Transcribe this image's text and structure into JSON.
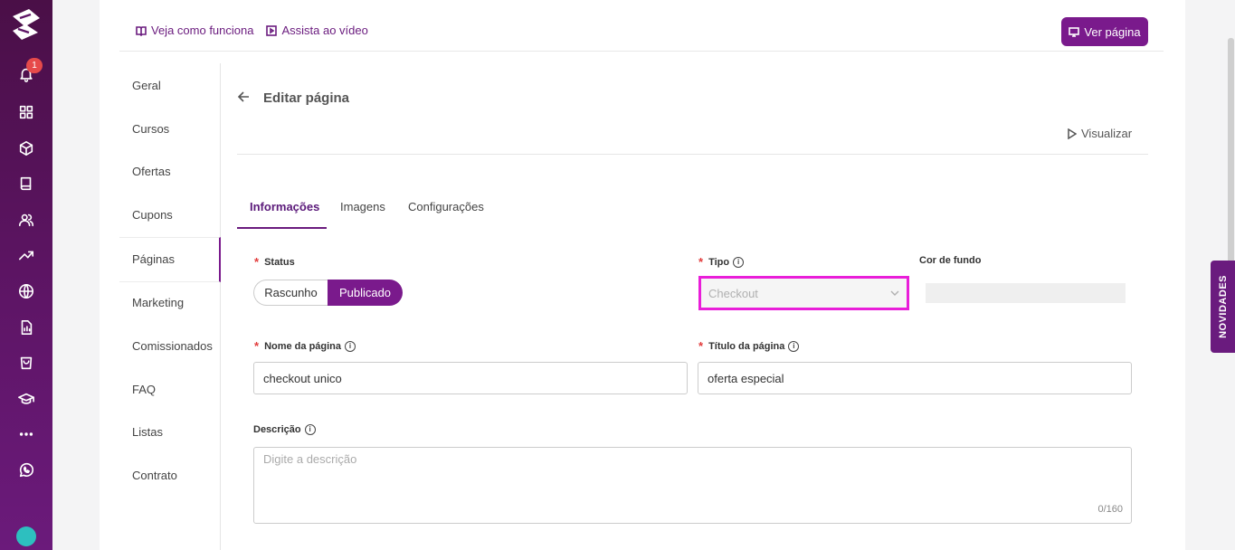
{
  "rail": {
    "notification_count": "1",
    "icons": [
      "bell-icon",
      "dashboard-grid-icon",
      "cube-icon",
      "book-icon",
      "users-icon",
      "trending-up-icon",
      "globe-icon",
      "report-icon",
      "shopping-bag-icon",
      "graduation-cap-icon",
      "more-dots-icon",
      "whatsapp-icon"
    ]
  },
  "top_links": {
    "how_it_works": "Veja como funciona",
    "watch_video": "Assista ao vídeo",
    "view_page_button": "Ver página"
  },
  "nav": {
    "items": [
      "Geral",
      "Cursos",
      "Ofertas",
      "Cupons",
      "Páginas",
      "Marketing",
      "Comissionados",
      "FAQ",
      "Listas",
      "Contrato"
    ],
    "active": "Páginas"
  },
  "header": {
    "title": "Editar página",
    "preview": "Visualizar"
  },
  "tabs": [
    "Informações",
    "Imagens",
    "Configurações"
  ],
  "form": {
    "status_label": "Status",
    "status_options": [
      "Rascunho",
      "Publicado"
    ],
    "status_selected": "Publicado",
    "tipo_label": "Tipo",
    "tipo_value": "Checkout",
    "cor_label": "Cor de fundo",
    "nome_label": "Nome da página",
    "nome_value": "checkout unico",
    "titulo_label": "Título da página",
    "titulo_value": "oferta especial",
    "descricao_label": "Descrição",
    "descricao_placeholder": "Digite a descrição",
    "descricao_counter": "0/160"
  },
  "novidades": "NOVIDADES",
  "colors": {
    "brand": "#7a1a8c",
    "rail": "#5e1566",
    "highlight_border": "#e91ed9",
    "required": "#e23b3b"
  }
}
